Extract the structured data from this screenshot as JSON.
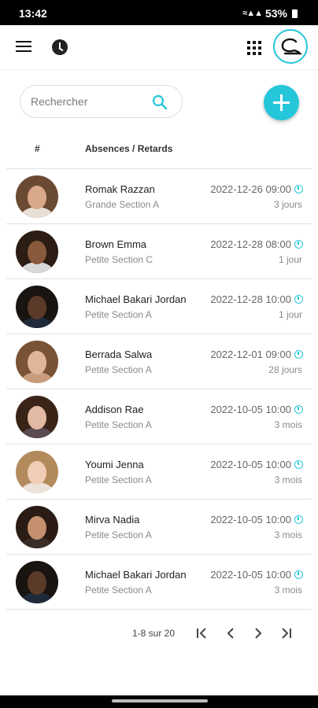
{
  "status_bar": {
    "time": "13:42",
    "battery": "53%"
  },
  "search": {
    "placeholder": "Rechercher"
  },
  "table": {
    "col_num": "#",
    "col_absences": "Absences / Retards",
    "rows": [
      {
        "name": "Romak Razzan",
        "class": "Grande Section A",
        "date": "2022-12-26 09:00",
        "duration": "3 jours",
        "skin": "#d9a98b",
        "hair": "#6b4a33",
        "shirt": "#e8e0d6"
      },
      {
        "name": "Brown Emma",
        "class": "Petite Section C",
        "date": "2022-12-28 08:00",
        "duration": "1 jour",
        "skin": "#8a5a3c",
        "hair": "#2b1d14",
        "shirt": "#d8d8d8"
      },
      {
        "name": "Michael Bakari Jordan",
        "class": "Petite Section A",
        "date": "2022-12-28 10:00",
        "duration": "1 jour",
        "skin": "#5a3a28",
        "hair": "#1a1410",
        "shirt": "#1f2a3a"
      },
      {
        "name": "Berrada Salwa",
        "class": "Petite Section A",
        "date": "2022-12-01 09:00",
        "duration": "28 jours",
        "skin": "#e0b59a",
        "hair": "#7a5236",
        "shirt": "#c89c7c"
      },
      {
        "name": "Addison Rae",
        "class": "Petite Section A",
        "date": "2022-10-05 10:00",
        "duration": "3 mois",
        "skin": "#e2b9a2",
        "hair": "#3a2418",
        "shirt": "#5a4a52"
      },
      {
        "name": "Youmi Jenna",
        "class": "Petite Section A",
        "date": "2022-10-05 10:00",
        "duration": "3 mois",
        "skin": "#f0cdb6",
        "hair": "#b28a5c",
        "shirt": "#ebe3da"
      },
      {
        "name": "Mirva Nadia",
        "class": "Petite Section A",
        "date": "2022-10-05 10:00",
        "duration": "3 mois",
        "skin": "#c4906e",
        "hair": "#2a1c14",
        "shirt": "#3a2c26"
      },
      {
        "name": "Michael Bakari Jordan",
        "class": "Petite Section A",
        "date": "2022-10-05 10:00",
        "duration": "3 mois",
        "skin": "#5a3a28",
        "hair": "#1a1410",
        "shirt": "#1f2a3a"
      }
    ]
  },
  "pagination": {
    "label": "1-8 sur 20"
  },
  "colors": {
    "accent": "#26c6da"
  },
  "icons": {
    "menu": "menu-icon",
    "history": "history-icon",
    "apps": "grid-icon",
    "search": "search-icon",
    "add": "plus-icon",
    "alarm": "alarm-clock-icon"
  }
}
